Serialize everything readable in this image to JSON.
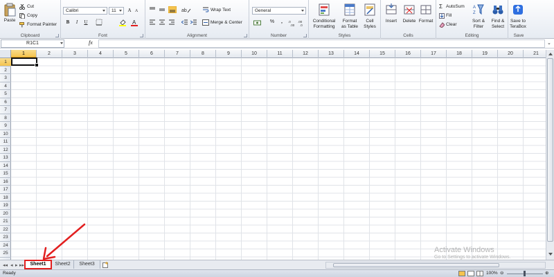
{
  "ribbon": {
    "clipboard": {
      "paste": "Paste",
      "cut": "Cut",
      "copy": "Copy",
      "format_painter": "Format Painter",
      "group": "Clipboard"
    },
    "font": {
      "name": "Calibri",
      "size": "11",
      "group": "Font"
    },
    "alignment": {
      "wrap_text": "Wrap Text",
      "merge_center": "Merge & Center",
      "group": "Alignment"
    },
    "number": {
      "format": "General",
      "group": "Number"
    },
    "styles": {
      "conditional": "Conditional\nFormatting",
      "format_table": "Format\nas Table",
      "cell_styles": "Cell\nStyles",
      "group": "Styles"
    },
    "cells": {
      "insert": "Insert",
      "delete": "Delete",
      "format": "Format",
      "group": "Cells"
    },
    "editing": {
      "autosum": "AutoSum",
      "fill": "Fill",
      "clear": "Clear",
      "sort_filter": "Sort &\nFilter",
      "find_select": "Find &\nSelect",
      "group": "Editing"
    },
    "save": {
      "terabox": "Save to\nTeraBox",
      "group": "Save"
    }
  },
  "formula_bar": {
    "name_box": "R1C1",
    "fx": "fx",
    "value": ""
  },
  "columns": [
    "1",
    "2",
    "3",
    "4",
    "5",
    "6",
    "7",
    "8",
    "9",
    "10",
    "11",
    "12",
    "13",
    "14",
    "15",
    "16",
    "17",
    "18",
    "19",
    "20",
    "21"
  ],
  "rows": [
    "1",
    "2",
    "3",
    "4",
    "5",
    "6",
    "7",
    "8",
    "9",
    "10",
    "11",
    "12",
    "13",
    "14",
    "15",
    "16",
    "17",
    "18",
    "19",
    "20",
    "21",
    "22",
    "23",
    "24",
    "25"
  ],
  "sheets": [
    "Sheet1",
    "Sheet2",
    "Sheet3"
  ],
  "status": {
    "ready": "Ready",
    "zoom": "100%"
  },
  "watermark": {
    "title": "Activate Windows",
    "subtitle": "Go to Settings to activate Windows."
  },
  "colors": {
    "annotation": "#e21f1f",
    "selected_header": "#f4c34e"
  }
}
